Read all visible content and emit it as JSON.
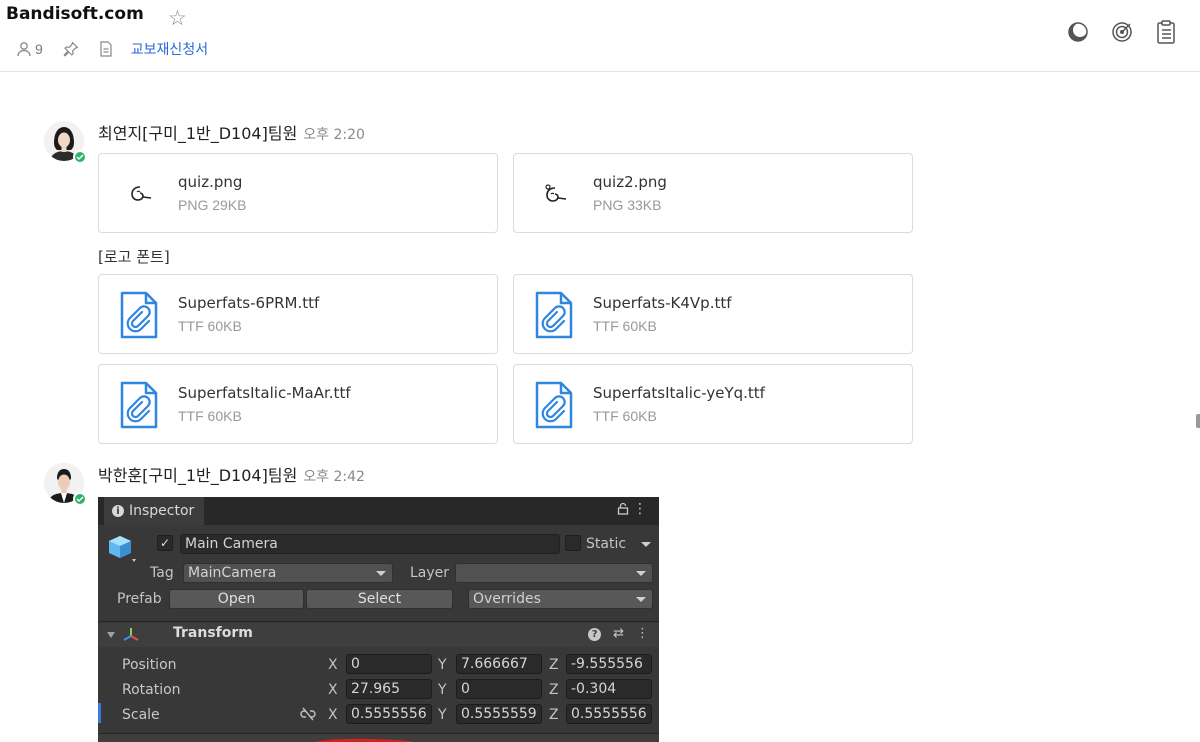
{
  "header": {
    "watermark": "Bandisoft.com",
    "member_count": "9",
    "link_label": "교보재신청서",
    "icons": [
      "half-moon-icon",
      "target-icon",
      "clipboard-icon"
    ]
  },
  "messages": [
    {
      "sender": "최연지[구미_1반_D104]팀원",
      "time": "오후 2:20",
      "files_top": [
        {
          "name": "quiz.png",
          "meta": "PNG 29KB"
        },
        {
          "name": "quiz2.png",
          "meta": "PNG 33KB"
        }
      ],
      "caption": "[로고 폰트]",
      "files_fonts": [
        {
          "name": "Superfats-6PRM.ttf",
          "meta": "TTF 60KB"
        },
        {
          "name": "Superfats-K4Vp.ttf",
          "meta": "TTF 60KB"
        },
        {
          "name": "SuperfatsItalic-MaAr.ttf",
          "meta": "TTF 60KB"
        },
        {
          "name": "SuperfatsItalic-yeYq.ttf",
          "meta": "TTF 60KB"
        }
      ]
    },
    {
      "sender": "박한훈[구미_1반_D104]팀원",
      "time": "오후 2:42"
    }
  ],
  "inspector": {
    "tab_label": "Inspector",
    "object_name": "Main Camera",
    "static_label": "Static",
    "tag_label": "Tag",
    "tag_value": "MainCamera",
    "layer_label": "Layer",
    "layer_value": "",
    "prefab_label": "Prefab",
    "open_label": "Open",
    "select_label": "Select",
    "overrides_label": "Overrides",
    "component_title": "Transform",
    "axes": {
      "x": "X",
      "y": "Y",
      "z": "Z"
    },
    "position": {
      "label": "Position",
      "x": "0",
      "y": "7.666667",
      "z": "-9.555556"
    },
    "rotation": {
      "label": "Rotation",
      "x": "27.965",
      "y": "0",
      "z": "-0.304"
    },
    "scale": {
      "label": "Scale",
      "x": "0.5555556",
      "y": "0.5555559",
      "z": "0.5555556"
    }
  }
}
